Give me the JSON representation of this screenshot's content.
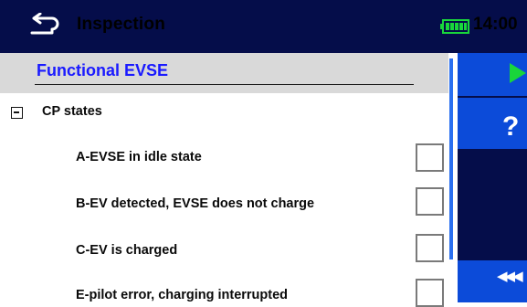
{
  "header": {
    "title": "Inspection",
    "clock": "14:00",
    "back_icon": "back-arrow-icon",
    "battery_icon": "battery-icon"
  },
  "section": {
    "title": "Functional EVSE"
  },
  "group": {
    "label": "CP states",
    "expanded": true
  },
  "items": [
    {
      "label": "A-EVSE in idle state",
      "checked": false
    },
    {
      "label": "B-EV detected, EVSE does not charge",
      "checked": false
    },
    {
      "label": "C-EV is charged",
      "checked": false
    },
    {
      "label": "E-pilot error, charging interrupted",
      "checked": false
    }
  ],
  "sidebar": {
    "help_label": "?",
    "more_label": "◀◀◀",
    "run_icon": "play-icon",
    "help_icon": "question-icon",
    "more_icon": "more-options-icon"
  },
  "colors": {
    "header_bg": "#050d4a",
    "sidebar_button": "#0c4bd9",
    "section_title": "#1a1aff",
    "play": "#19d63b",
    "scrollbar": "#2a6ff0"
  }
}
